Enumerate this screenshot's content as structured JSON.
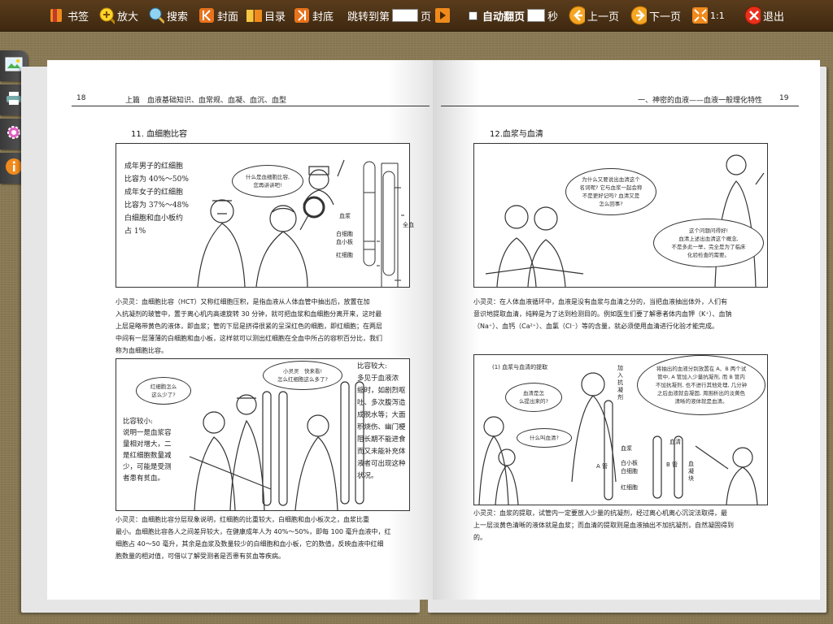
{
  "toolbar": {
    "bookmark": "书签",
    "zoom": "放大",
    "search": "搜索",
    "cover": "封面",
    "toc": "目录",
    "back_cover": "封底",
    "jump_prefix": "跳转到第",
    "jump_suffix": "页",
    "auto_flip": "自动翻页",
    "seconds": "秒",
    "prev": "上一页",
    "next": "下一页",
    "ratio": "1:1",
    "exit": "退出"
  },
  "left_page": {
    "page_number": "18",
    "header": "上篇　血液基础知识、血常规、血凝、血沉、血型",
    "section_title": "11. 血细胞比容",
    "box1": {
      "caption": [
        "成年男子的红细胞",
        "比容为 40%～50%",
        "成年女子的红细胞",
        "比容为 37%～48%",
        "白细胞和血小板约",
        "占 1%"
      ],
      "bubble": [
        "什么是血细胞比容,",
        "您再讲讲吧!"
      ],
      "label_plasma": "血浆",
      "label_wbc": "白细胞",
      "label_plt": "血小板",
      "label_rbc": "红细胞",
      "label_whole": "全血"
    },
    "paragraph1": [
      "小灵灵：血细胞比容（HCT）又称红细胞压积，是指血液从人体血管中抽出后，放置在加",
      "入抗凝剂的玻管中，置于离心机内高速旋转 30 分钟，就可把血浆和血细胞分离开来，这时最",
      "上层是略带黄色的液体，即血浆；管的下层是挤得很紧的呈深红色的细胞，即红细胞；在两层",
      "中间有一层薄薄的白细胞和血小板，这样就可以测出红细胞在全血中所占的容积百分比，我们",
      "称为血细胞比容。"
    ],
    "box2": {
      "bubble1": [
        "小灵灵　快来看!",
        "怎么红细胞这么多了?"
      ],
      "bubble2": [
        "红细胞怎么",
        "这么少了?"
      ],
      "left_caption": [
        "比容较小:",
        "说明一是血浆容",
        "量相对增大，二",
        "是红细胞数量减",
        "少，可能是受测",
        "者患有贫血。"
      ],
      "right_caption": [
        "比容较大:",
        "多见于血液浓",
        "缩时，如剧烈呕",
        "吐、多次腹泻造",
        "成脱水等；大面",
        "积烧伤、幽门梗",
        "阻长期不能进食",
        "而又未能补充体",
        "液者可出现这种",
        "状况。"
      ]
    },
    "paragraph2": [
      "小灵灵：血细胞比容分层现象说明，红细胞的比重较大，白细胞和血小板次之，血浆比重",
      "最小。血细胞比容各人之间差异较大，在健康成年人为 40%～50%，即每 100 毫升血液中，红",
      "细胞占 40～50 毫升，其余是血浆及数量较少的白细胞和血小板，它的数值，反映血液中红细",
      "胞数量的相对值，可借以了解受测者是否患有贫血等疾病。"
    ]
  },
  "right_page": {
    "page_number": "19",
    "header": "一、神密的血液——血液一般理化特性",
    "section_title": "12.血浆与血清",
    "box1": {
      "bubble1": [
        "为什么又要说出血清这个",
        "名词呢? 它与血浆一起会称",
        "不是更好记吗? 血清又是",
        "怎么回事?"
      ],
      "bubble2": [
        "这个问题问得好!",
        "血清上述出血清这个概念,",
        "不是多此一举，完全是为了临床",
        "化验检查的需要。"
      ]
    },
    "paragraph1": [
      "小灵灵：在人体血液循环中，血液是没有血浆与血清之分的，当把血液抽出体外，人们有",
      "意识地提取血清，纯粹是为了达到检测目的。例如医生们要了解患者体内血钾（K⁺）、血钠",
      "（Na⁺）、血钙（Ca²⁺）、血氯（Cl⁻）等的含量，就必须使用血清进行化验才能完成。"
    ],
    "box2": {
      "title": "(1) 血浆与血清的提取",
      "nurse_label": [
        "加",
        "入",
        "抗",
        "凝",
        "剂"
      ],
      "bubble_left": [
        "血清是怎",
        "么提出来的?"
      ],
      "bubble_small": "什么叫血清?",
      "bubble_right": [
        "将抽出的血液分别放置在 A、B 两个试",
        "管中, A 管加入少量抗凝剂, 而 B 管内",
        "不加抗凝剂, 也不进行其他处理, 几分钟",
        "之后血液就会凝固, 周围析出的淡黄色",
        "清晰的液体就是血清。"
      ],
      "tube_a": "A 管",
      "tube_b": "B 管",
      "label_plasma": "血浆",
      "label_wbc_plt": [
        "白小板",
        "白细胞"
      ],
      "label_rbc": "红细胞",
      "label_serum": "血清",
      "label_clot": [
        "血",
        "凝",
        "块"
      ]
    },
    "paragraph2": [
      "小灵灵：血浆的提取，试管内一定要放入少量的抗凝剂，经过离心机离心沉淀法取得，最",
      "上一层淡黄色清晰的液体就是血浆；而血清的提取则是血液抽出不加抗凝剂，自然凝固得到",
      "的。"
    ]
  }
}
